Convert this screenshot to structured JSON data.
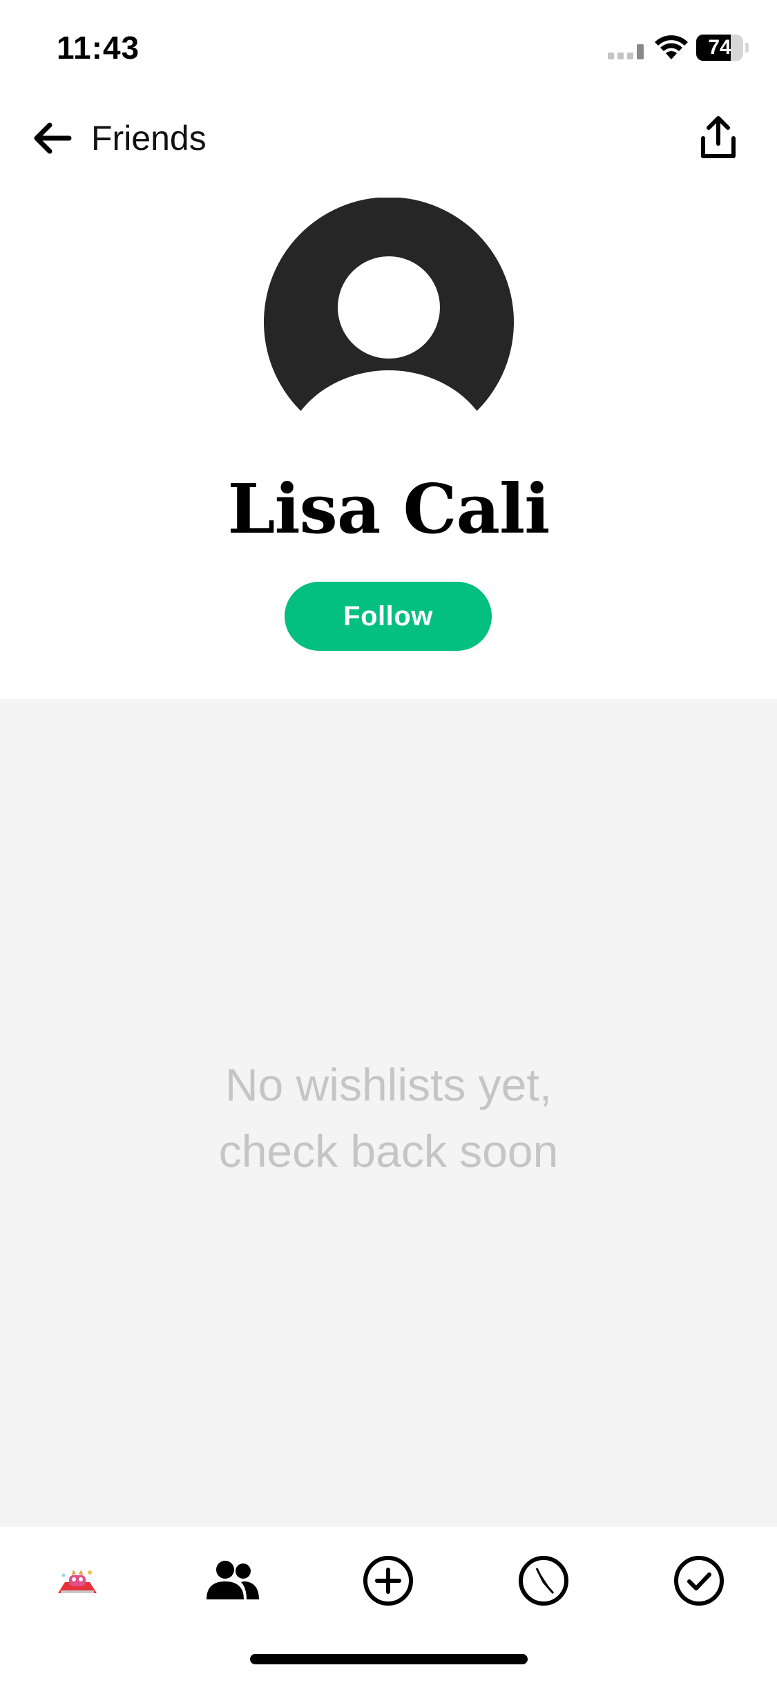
{
  "status_bar": {
    "time": "11:43",
    "battery_percent": 74,
    "battery_label": "74",
    "icons": [
      "cellular-signal-icon",
      "wifi-icon",
      "battery-icon"
    ]
  },
  "nav": {
    "back_label": "Friends",
    "back_icon": "arrow-left-icon",
    "share_icon": "share-icon"
  },
  "profile": {
    "avatar_icon": "default-avatar-icon",
    "name": "Lisa Cali",
    "follow_label": "Follow"
  },
  "empty_state": {
    "line1": "No wishlists yet,",
    "line2": "check back soon"
  },
  "tab_bar": {
    "tabs": [
      {
        "name": "home",
        "icon": "app-logo-icon"
      },
      {
        "name": "friends",
        "icon": "friends-icon",
        "active": true
      },
      {
        "name": "add",
        "icon": "plus-circle-icon"
      },
      {
        "name": "explore",
        "icon": "compass-icon"
      },
      {
        "name": "done",
        "icon": "check-circle-icon"
      }
    ]
  },
  "colors": {
    "accent": "#03bf80",
    "avatar": "#262626",
    "empty_bg": "#f4f4f4",
    "empty_text": "#c5c5c5"
  }
}
